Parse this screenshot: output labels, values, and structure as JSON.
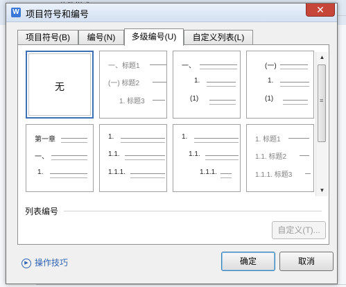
{
  "background_window": {
    "title_fragment": "修改样式"
  },
  "dialog": {
    "title": "项目符号和编号",
    "icon_glyph": "W",
    "close_glyph": "✕"
  },
  "tabs": [
    {
      "label": "项目符号(B)",
      "active": false
    },
    {
      "label": "编号(N)",
      "active": false
    },
    {
      "label": "多级编号(U)",
      "active": true
    },
    {
      "label": "自定义列表(L)",
      "active": false
    }
  ],
  "grid": {
    "none_label": "无",
    "cells": [
      {
        "rows": [
          "一、标题1",
          "(一) 标题2",
          "1. 标题3"
        ]
      },
      {
        "rows": [
          "一、",
          "1.",
          "(1)"
        ]
      },
      {
        "rows": [
          "(一)",
          "1.",
          "(1)"
        ]
      },
      {
        "rows": [
          "第一章",
          "一、",
          "1."
        ]
      },
      {
        "rows": [
          "1.",
          "1.1.",
          "1.1.1."
        ]
      },
      {
        "rows": [
          "1.",
          "1.1.",
          "1.1.1."
        ]
      },
      {
        "rows": [
          "1. 标题1",
          "1.1. 标题2",
          "1.1.1. 标题3"
        ]
      }
    ]
  },
  "list_numbering": {
    "label": "列表编号",
    "customize_button": "自定义(T)..."
  },
  "footer": {
    "tips_label": "操作技巧",
    "ok_label": "确定",
    "cancel_label": "取消"
  },
  "colors": {
    "accent": "#3b6fb6",
    "link": "#2f63b3",
    "close": "#c7463a"
  }
}
